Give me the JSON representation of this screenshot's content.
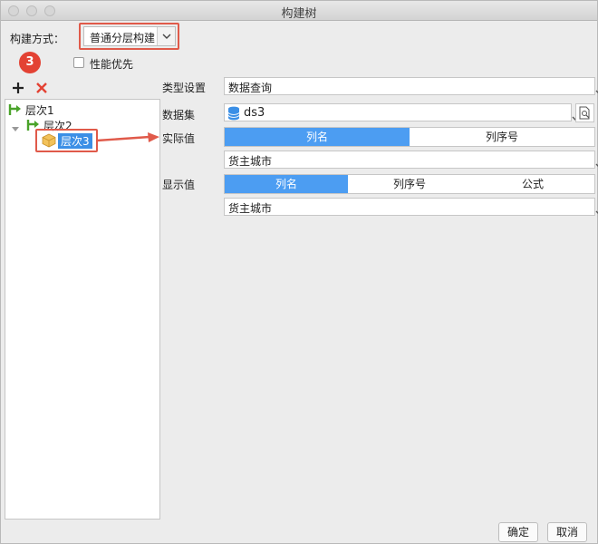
{
  "window": {
    "title": "构建树"
  },
  "build_method": {
    "label": "构建方式：",
    "value": "普通分层构建"
  },
  "badge": {
    "number": "3"
  },
  "performance": {
    "label": "性能优先",
    "checked": false
  },
  "toolbar": {
    "add_icon": "plus-icon",
    "delete_icon": "x-icon"
  },
  "tree": {
    "items": [
      {
        "label": "层次1",
        "level": 0,
        "icon": "level-icon"
      },
      {
        "label": "层次2",
        "level": 1,
        "icon": "level-icon"
      },
      {
        "label": "层次3",
        "level": 2,
        "icon": "box-icon",
        "selected": true
      }
    ]
  },
  "form": {
    "type_label": "类型设置",
    "type_value": "数据查询",
    "dataset_label": "数据集",
    "dataset_value": "ds3",
    "actual_label": "实际值",
    "actual_tabs": [
      "列名",
      "列序号"
    ],
    "actual_active": 0,
    "actual_value": "货主城市",
    "display_label": "显示值",
    "display_tabs": [
      "列名",
      "列序号",
      "公式"
    ],
    "display_active": 0,
    "display_value": "货主城市"
  },
  "buttons": {
    "ok": "确定",
    "cancel": "取消"
  },
  "colors": {
    "accent": "#4c9df2",
    "highlight": "#e05a4a",
    "badge": "#e34233"
  }
}
